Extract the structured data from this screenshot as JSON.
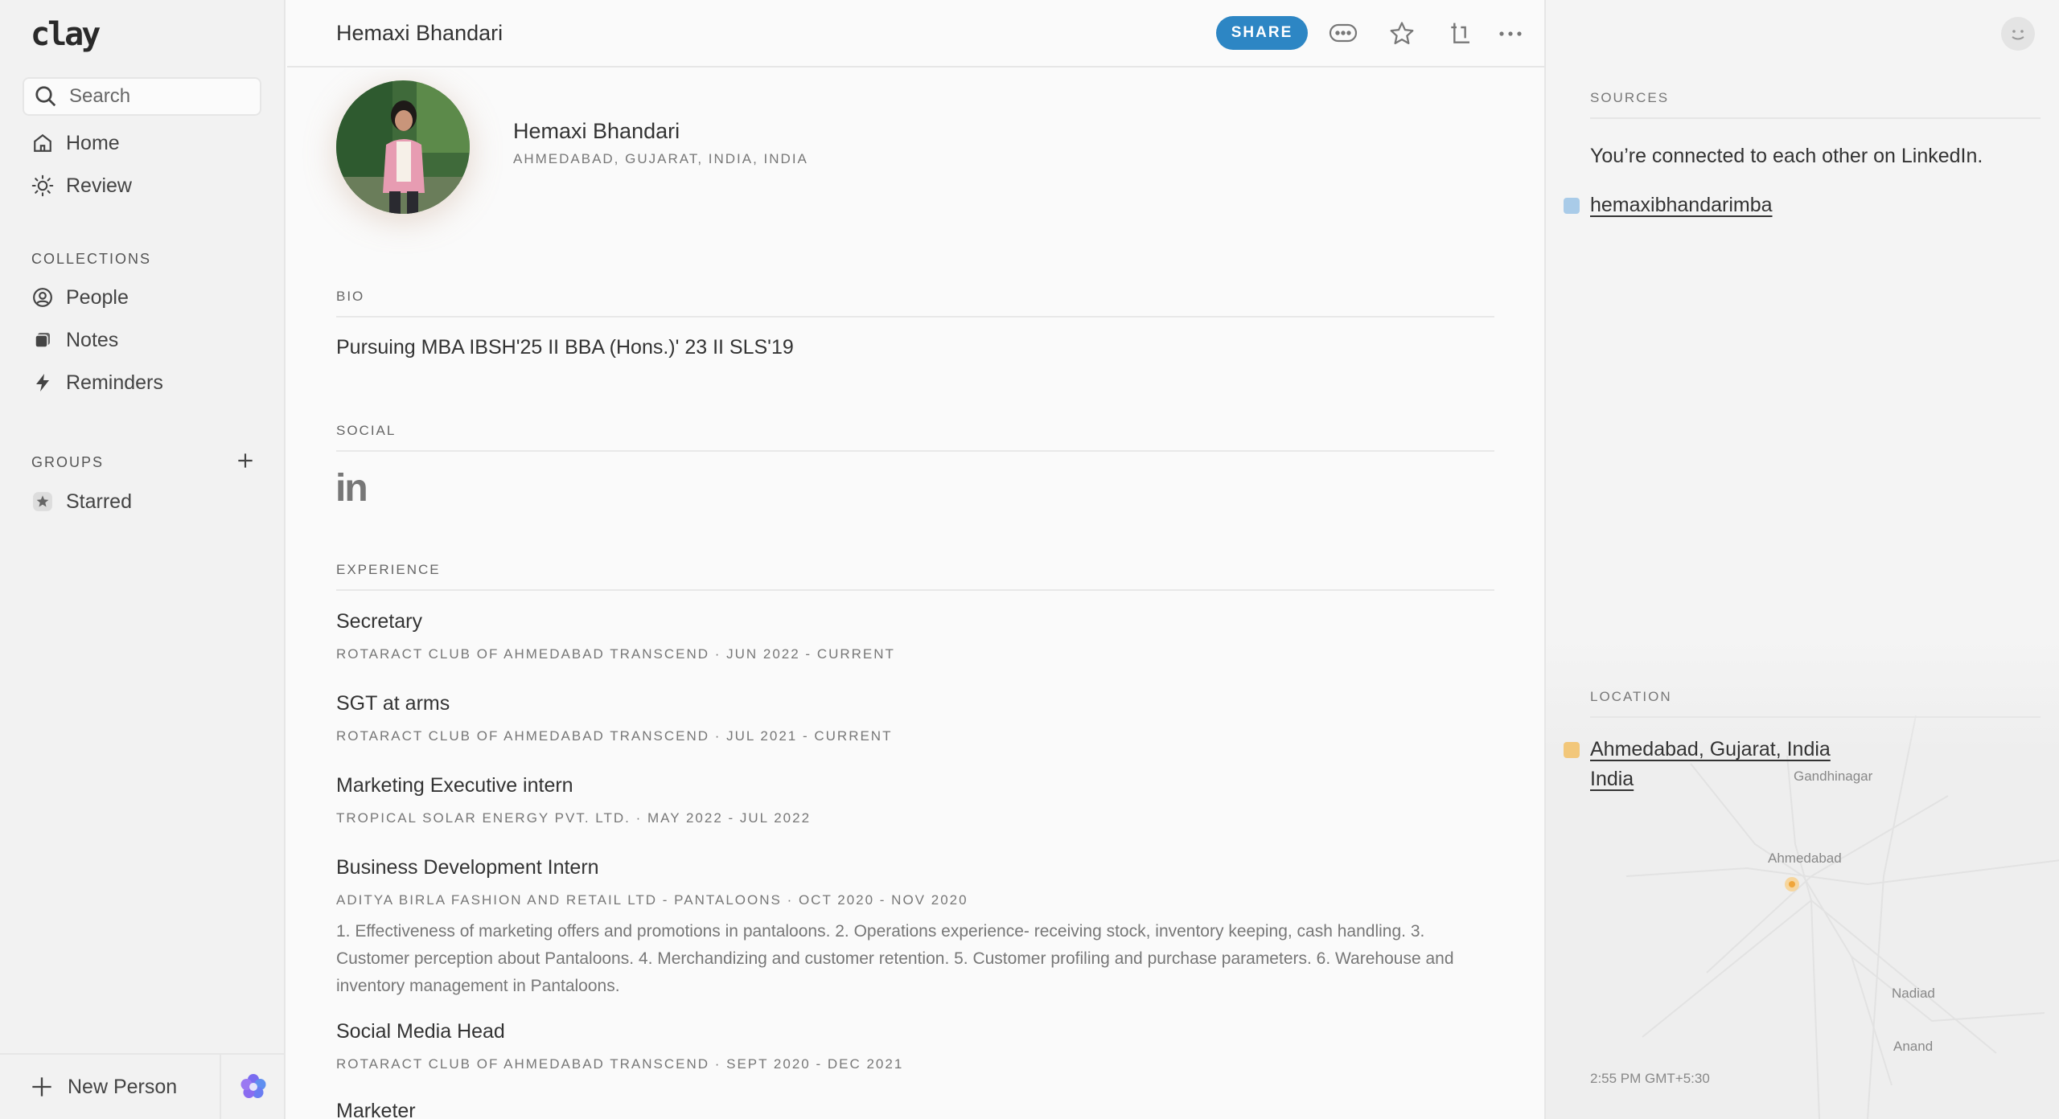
{
  "sidebar": {
    "logo": "clay",
    "search": {
      "placeholder": "Search"
    },
    "nav": [
      {
        "label": "Home",
        "icon": "home-icon"
      },
      {
        "label": "Review",
        "icon": "sun-icon"
      }
    ],
    "collections_label": "COLLECTIONS",
    "collections": [
      {
        "label": "People",
        "icon": "person-circle-icon"
      },
      {
        "label": "Notes",
        "icon": "notes-icon"
      },
      {
        "label": "Reminders",
        "icon": "lightning-icon"
      }
    ],
    "groups_label": "GROUPS",
    "groups": [
      {
        "label": "Starred",
        "icon": "star-badge-icon"
      }
    ],
    "new_person_label": "New Person"
  },
  "header": {
    "title": "Hemaxi Bhandari",
    "share_label": "SHARE",
    "icons": [
      "message-icon",
      "star-icon",
      "export-icon",
      "more-icon"
    ]
  },
  "profile": {
    "name": "Hemaxi Bhandari",
    "location": "AHMEDABAD, GUJARAT, INDIA, INDIA",
    "bio_label": "BIO",
    "bio": "Pursuing MBA IBSH'25 II BBA (Hons.)' 23 II SLS'19",
    "social_label": "SOCIAL",
    "social_icon": "in",
    "experience_label": "EXPERIENCE",
    "experience": [
      {
        "title": "Secretary",
        "meta": "ROTARACT CLUB OF AHMEDABAD TRANSCEND · JUN 2022 - CURRENT",
        "desc": ""
      },
      {
        "title": "SGT at arms",
        "meta": "ROTARACT CLUB OF AHMEDABAD TRANSCEND · JUL 2021 - CURRENT",
        "desc": ""
      },
      {
        "title": "Marketing Executive intern",
        "meta": "TROPICAL SOLAR ENERGY PVT. LTD. · MAY 2022 - JUL 2022",
        "desc": ""
      },
      {
        "title": "Business Development Intern",
        "meta": "ADITYA BIRLA FASHION AND RETAIL LTD - PANTALOONS · OCT 2020 - NOV 2020",
        "desc": "1. Effectiveness of marketing offers and promotions in pantaloons. 2. Operations experience- receiving stock, inventory keeping, cash handling. 3. Customer perception about Pantaloons. 4. Merchandizing and customer retention. 5. Customer profiling and purchase parameters. 6. Warehouse and inventory management in Pantaloons."
      },
      {
        "title": "Social Media Head",
        "meta": "ROTARACT CLUB OF AHMEDABAD TRANSCEND · SEPT 2020 - DEC 2021",
        "desc": ""
      },
      {
        "title": "Marketer",
        "meta": "",
        "desc": ""
      }
    ]
  },
  "right_panel": {
    "sources_label": "SOURCES",
    "sources_text": "You’re connected to each other on LinkedIn.",
    "linkedin_handle": "hemaxibhandarimba",
    "location_label": "LOCATION",
    "location_line1": "Ahmedabad, Gujarat, India",
    "location_line2": "India",
    "map_labels": [
      "Gandhinagar",
      "Ahmedabad",
      "Nadiad",
      "Anand"
    ],
    "time": "2:55 PM GMT+5:30"
  },
  "colors": {
    "accent": "#2d86c4",
    "linkedin_badge": "#a9cbe8",
    "location_badge": "#f2c77a"
  }
}
